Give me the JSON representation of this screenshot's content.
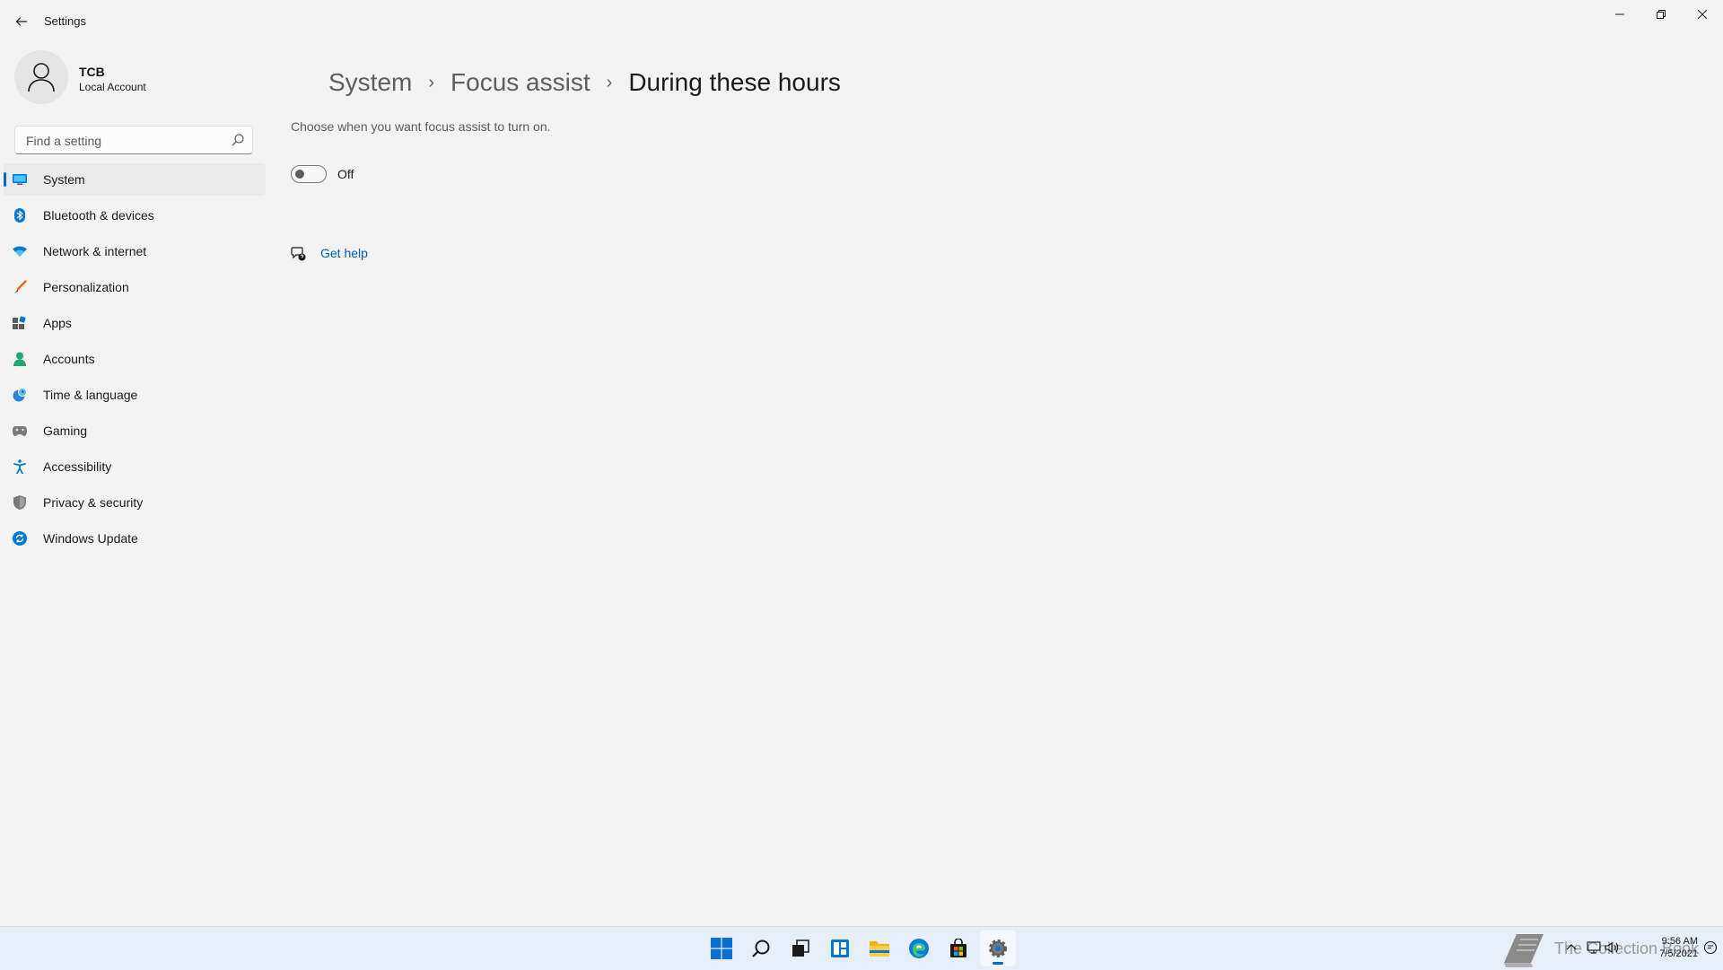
{
  "window": {
    "title": "Settings"
  },
  "profile": {
    "name": "TCB",
    "account_type": "Local Account"
  },
  "search": {
    "placeholder": "Find a setting"
  },
  "sidebar": {
    "items": [
      {
        "label": "System",
        "icon": "system-icon",
        "active": true
      },
      {
        "label": "Bluetooth & devices",
        "icon": "bluetooth-icon"
      },
      {
        "label": "Network & internet",
        "icon": "wifi-icon"
      },
      {
        "label": "Personalization",
        "icon": "brush-icon"
      },
      {
        "label": "Apps",
        "icon": "apps-icon"
      },
      {
        "label": "Accounts",
        "icon": "person-icon"
      },
      {
        "label": "Time & language",
        "icon": "globe-clock-icon"
      },
      {
        "label": "Gaming",
        "icon": "gamepad-icon"
      },
      {
        "label": "Accessibility",
        "icon": "accessibility-icon"
      },
      {
        "label": "Privacy & security",
        "icon": "shield-icon"
      },
      {
        "label": "Windows Update",
        "icon": "update-icon"
      }
    ]
  },
  "breadcrumb": {
    "items": [
      "System",
      "Focus assist",
      "During these hours"
    ]
  },
  "main": {
    "description": "Choose when you want focus assist to turn on.",
    "toggle_state": "Off",
    "get_help": "Get help"
  },
  "taskbar": {
    "apps": [
      "start",
      "search",
      "task-view",
      "widgets",
      "file-explorer",
      "edge",
      "store",
      "settings"
    ],
    "watermark": "The Collection Book",
    "time": "9:56 AM",
    "date": "7/5/2021"
  },
  "colors": {
    "accent": "#0067c0",
    "link": "#005fb8",
    "background": "#f3f3f3"
  }
}
